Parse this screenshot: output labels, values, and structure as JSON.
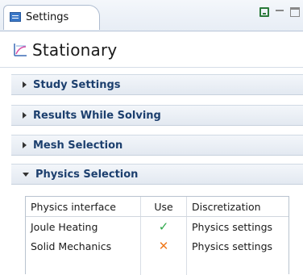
{
  "tab": {
    "label": "Settings"
  },
  "header": {
    "title": "Stationary"
  },
  "sections": [
    {
      "label": "Study Settings",
      "expanded": false
    },
    {
      "label": "Results While Solving",
      "expanded": false
    },
    {
      "label": "Mesh Selection",
      "expanded": false
    },
    {
      "label": "Physics Selection",
      "expanded": true
    }
  ],
  "physics_table": {
    "columns": [
      "Physics interface",
      "Use",
      "Discretization"
    ],
    "rows": [
      {
        "interface": "Joule Heating",
        "use": "check",
        "discretization": "Physics settings"
      },
      {
        "interface": "Solid Mechanics",
        "use": "cross",
        "discretization": "Physics settings"
      }
    ]
  },
  "colors": {
    "check": "#2ea84a",
    "cross": "#f07a1e",
    "section_text": "#1c3f6e"
  }
}
